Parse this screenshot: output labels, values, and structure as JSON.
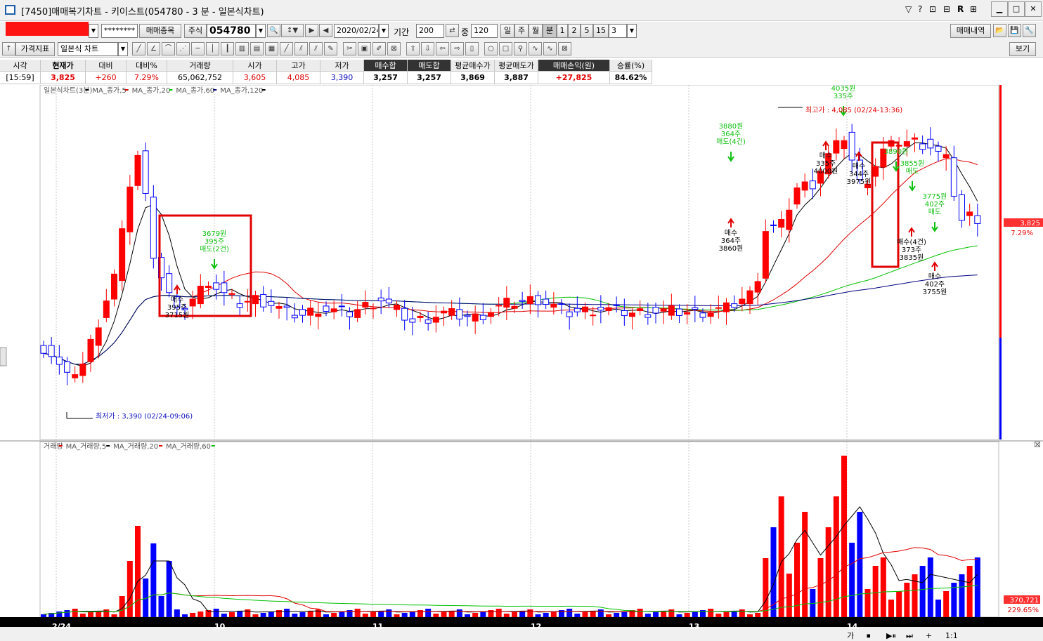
{
  "window": {
    "title": "[7450]매매복기차트 - 키이스트(054780 - 3 분 - 일본식차트)",
    "controls": [
      "▽",
      "?",
      "⊡",
      "⊟",
      "R",
      "⊞"
    ]
  },
  "toolbar": {
    "account_masked": "********",
    "trade_item_button": "매매종목",
    "market_type": "주식",
    "code": "054780",
    "date": "2020/02/24",
    "period_label": "기간",
    "period_value": "200",
    "count_label": "중",
    "count_value": "120",
    "units": [
      "일",
      "주",
      "월",
      "분",
      "1",
      "2",
      "5",
      "15"
    ],
    "minute_value": "3",
    "trade_history_button": "매매내역",
    "indicator_button": "가격지표",
    "chart_type": "일본식 차트",
    "view_button": "보기"
  },
  "quote": {
    "headers": [
      "시각",
      "현재가",
      "대비",
      "대비%",
      "거래량",
      "시가",
      "고가",
      "저가",
      "매수합",
      "매도합",
      "평균매수가",
      "평균매도가",
      "매매손익(원)",
      "승률(%)"
    ],
    "values": [
      "[15:59]",
      "3,825",
      "+260",
      "7.29%",
      "65,062,752",
      "3,605",
      "4,085",
      "3,390",
      "3,257",
      "3,257",
      "3,869",
      "3,887",
      "+27,825",
      "84.62%"
    ]
  },
  "price_panel": {
    "legend": [
      "일본식차트(3분)",
      "MA_종가,5",
      "MA_종가,20",
      "MA_종가,60",
      "MA_종가,120"
    ],
    "low_label": "최저가 : 3,390 (02/24-09:06)",
    "high_label": "최고가 : 4,085 (02/24-13:36)",
    "price_tag": "3,825",
    "pct_tag": "7.29%",
    "colors": {
      "up": "#ff0000",
      "down": "#0000ff",
      "ma5": "#000000",
      "ma20": "#e00000",
      "ma60": "#00c000",
      "ma120": "#000080"
    }
  },
  "annotations": [
    {
      "kind": "sell",
      "lines": [
        "3679원",
        "395주",
        "매도(2건)"
      ]
    },
    {
      "kind": "buy",
      "lines": [
        "매수",
        "395주",
        "3715원"
      ]
    },
    {
      "kind": "sell",
      "lines": [
        "3880원",
        "364주",
        "매도(4건)"
      ]
    },
    {
      "kind": "buy",
      "lines": [
        "매수",
        "364주",
        "3860원"
      ]
    },
    {
      "kind": "buy",
      "lines": [
        "매수",
        "335주",
        "4000원"
      ]
    },
    {
      "kind": "sell",
      "lines": [
        "4035원",
        "335주"
      ]
    },
    {
      "kind": "buy",
      "lines": [
        "매수",
        "344주",
        "3975원"
      ]
    },
    {
      "kind": "sell",
      "lines": [
        "3890원"
      ]
    },
    {
      "kind": "sell",
      "lines": [
        "3855원",
        "매도"
      ]
    },
    {
      "kind": "sell",
      "lines": [
        "3775원",
        "402주",
        "매도"
      ]
    },
    {
      "kind": "buy",
      "lines": [
        "매수(4건)",
        "373주",
        "3835원"
      ]
    },
    {
      "kind": "buy",
      "lines": [
        "매수",
        "402주",
        "3755원"
      ]
    }
  ],
  "volume_panel": {
    "legend": [
      "거래량",
      "MA_거래량,5",
      "MA_거래량,20",
      "MA_거래량,60"
    ],
    "volume_tag": "370,721",
    "pct_tag": "229.65%"
  },
  "x_axis": [
    "2/24",
    "10",
    "11",
    "12",
    "13",
    "14"
  ],
  "bottom_bar": [
    "가",
    "⏹",
    "▶⏸",
    "⏭",
    "+",
    "1:1"
  ]
}
